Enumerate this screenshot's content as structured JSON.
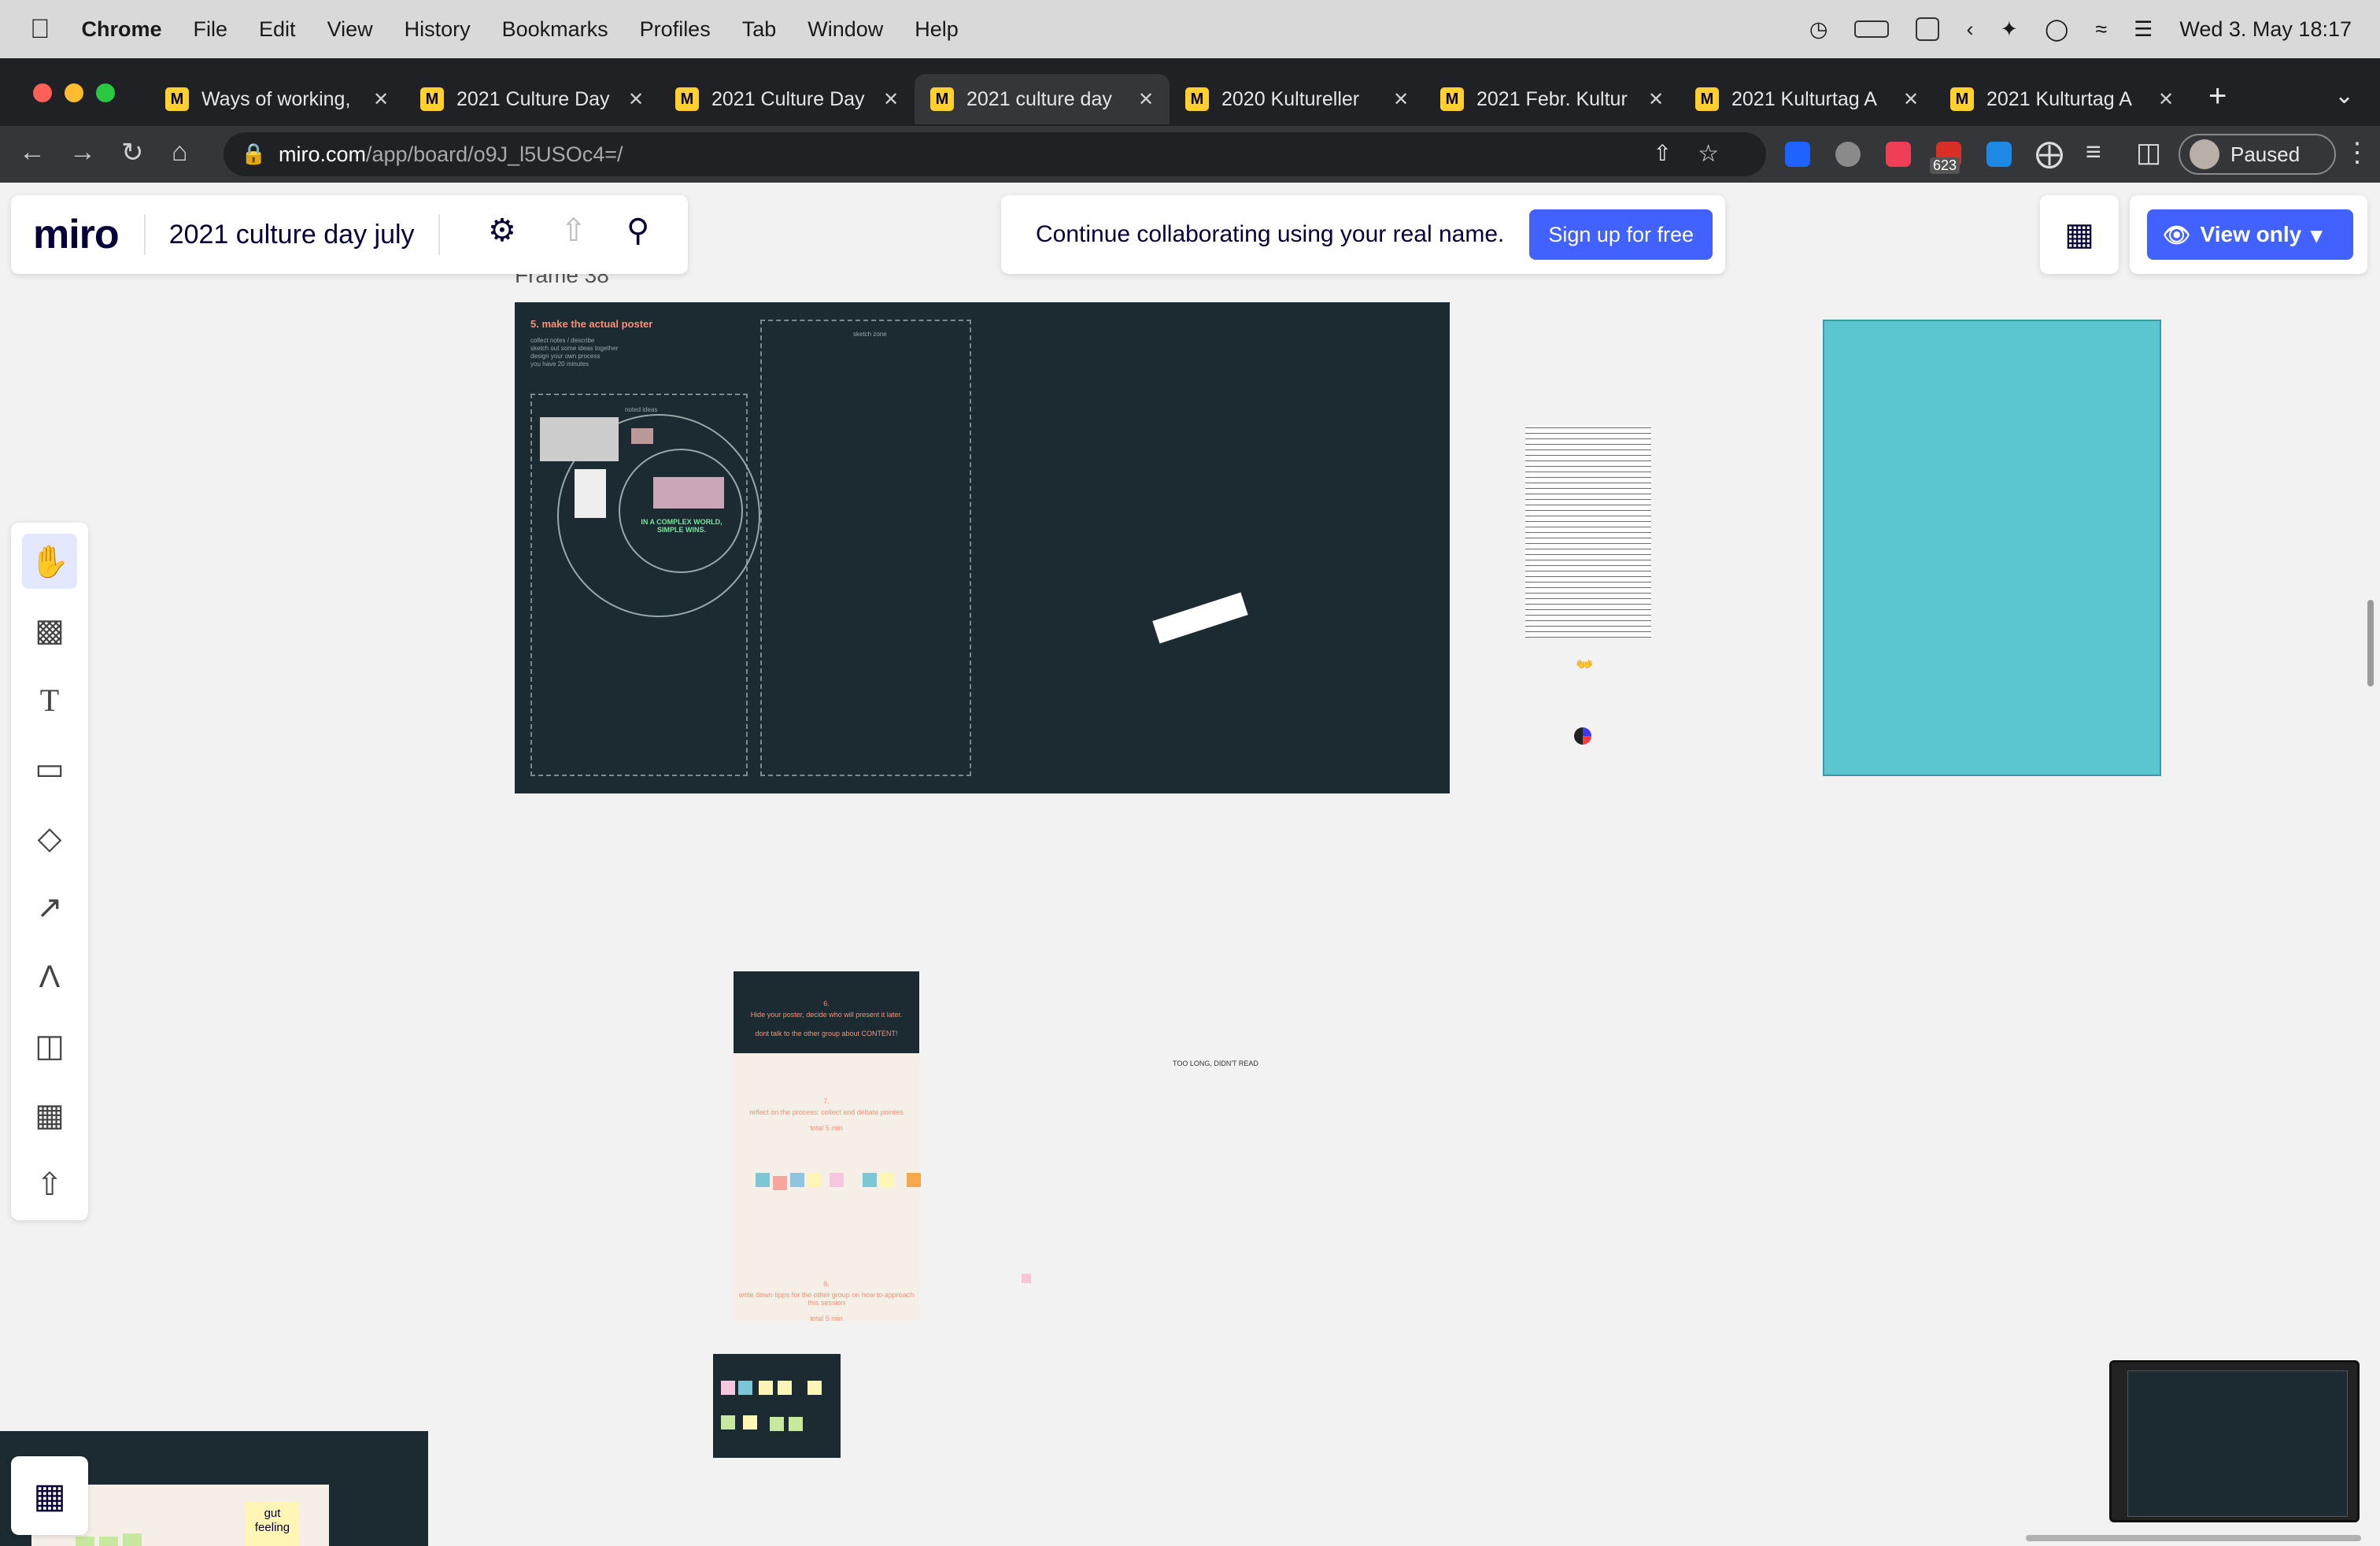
{
  "menubar": {
    "apple": "",
    "app": "Chrome",
    "items": [
      "File",
      "Edit",
      "View",
      "History",
      "Bookmarks",
      "Profiles",
      "Tab",
      "Window",
      "Help"
    ],
    "datetime": "Wed 3. May  18:17"
  },
  "tabs": [
    {
      "title": "Ways of working,",
      "active": false
    },
    {
      "title": "2021 Culture Day",
      "active": false
    },
    {
      "title": "2021 Culture Day",
      "active": false
    },
    {
      "title": "2021 culture day",
      "active": true
    },
    {
      "title": "2020 Kultureller",
      "active": false
    },
    {
      "title": "2021 Febr. Kultur",
      "active": false
    },
    {
      "title": "2021 Kulturtag A",
      "active": false
    },
    {
      "title": "2021 Kulturtag A",
      "active": false
    }
  ],
  "browser": {
    "url_host": "miro.com",
    "url_path": "/app/board/o9J_l5USOc4=/",
    "profile_status": "Paused",
    "badge_count": "623"
  },
  "miro": {
    "logo": "miro",
    "board_title": "2021 culture day july",
    "banner_text": "Continue collaborating using your real name.",
    "signup_label": "Sign up for free",
    "view_only_label": "View only"
  },
  "canvas": {
    "frame_label": "Frame 38",
    "poster_title": "5. make the actual poster",
    "poster_notes": [
      "collect notes / describe",
      "sketch out some ideas together",
      "design your own process",
      "you have 20 minutes"
    ],
    "zone_label_left": "noted ideas",
    "zone_label_right": "sketch zone",
    "poster_slogan": "IN A COMPLEX WORLD, SIMPLE WINS.",
    "step6_title": "6.",
    "step6_text": "Hide your poster, decide who will present it later.",
    "step6_note": "dont talk to the other group about CONTENT!",
    "step7_title": "7.",
    "step7_text": "reflect on the process: collect and debate pointes",
    "step7_time": "total 5 min",
    "step8_title": "8.",
    "step8_text": "write down tipps for the other group on how to approach this session",
    "step8_time": "total 5 min",
    "tldr": "TOO LONG, DIDN'T READ",
    "gut_feeling": "gut feeling"
  },
  "colors": {
    "miro_blue": "#4262ff",
    "frame_dark": "#1b2b31",
    "teal": "#5bc6d0",
    "accent_orange": "#ff8d74"
  }
}
